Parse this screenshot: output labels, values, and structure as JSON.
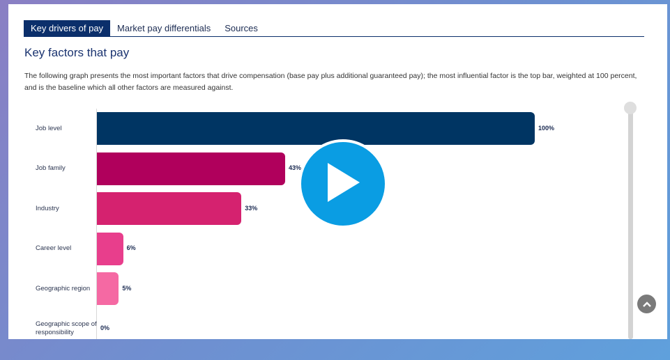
{
  "tabs": [
    {
      "label": "Key drivers of pay",
      "active": true
    },
    {
      "label": "Market pay differentials",
      "active": false
    },
    {
      "label": "Sources",
      "active": false
    }
  ],
  "heading": "Key factors that pay",
  "description": "The following graph presents the most important factors that drive compensation (base pay plus additional guaranteed pay); the most influential factor is the top bar, weighted at 100 percent, and is the baseline which all other factors are measured against.",
  "chart_data": {
    "type": "bar",
    "orientation": "horizontal",
    "categories": [
      "Job level",
      "Job family",
      "Industry",
      "Career level",
      "Geographic region",
      "Geographic scope of responsibility"
    ],
    "values": [
      100,
      43,
      33,
      6,
      5,
      0
    ],
    "value_labels": [
      "100%",
      "43%",
      "33%",
      "6%",
      "5%",
      "0%"
    ],
    "colors": [
      "#003563",
      "#b0005c",
      "#d5226f",
      "#e83e8c",
      "#f569a3",
      "#f7a6c6"
    ],
    "xlim": [
      0,
      100
    ]
  },
  "icons": {
    "play": "play-icon",
    "scroll_top": "chevron-up-icon"
  }
}
